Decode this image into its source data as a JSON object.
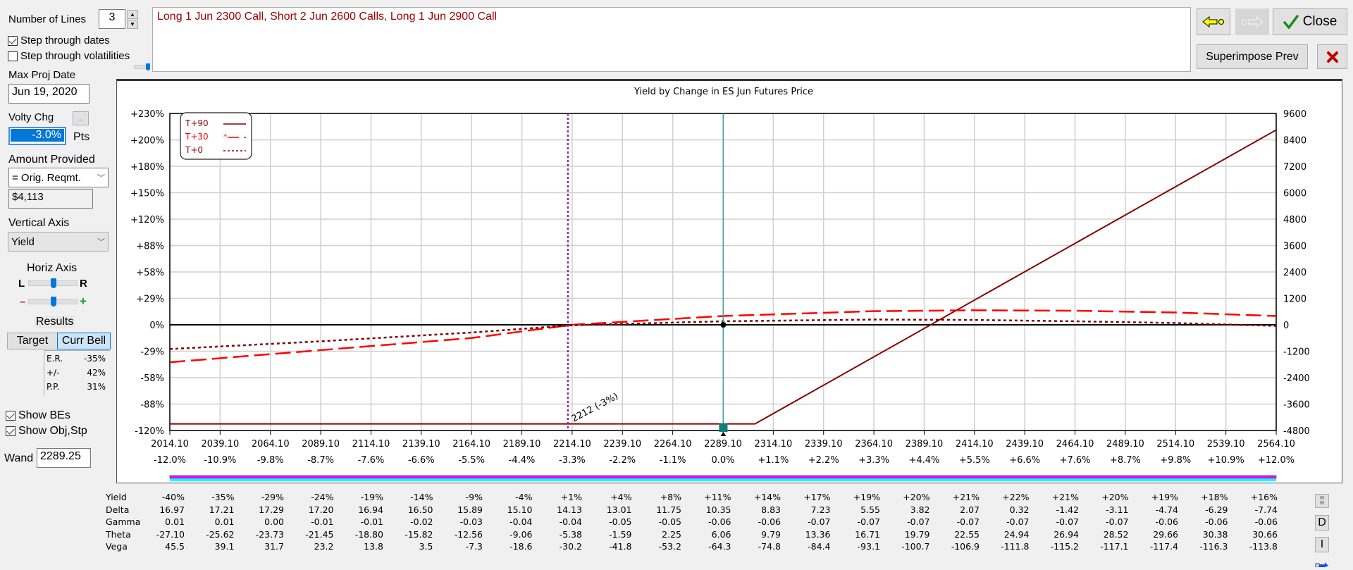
{
  "left_panel": {
    "number_of_lines_label": "Number of Lines",
    "number_of_lines_value": "3",
    "step_dates_label": "Step through dates",
    "step_dates_checked": true,
    "step_vols_label": "Step through volatilities",
    "step_vols_checked": false,
    "max_proj_date_label": "Max Proj Date",
    "max_proj_date_value": "Jun 19, 2020",
    "volty_chg_label": "Volty Chg",
    "volty_more_label": "...",
    "volty_chg_value": "-3.0%",
    "volty_units": "Pts",
    "amount_provided_label": "Amount Provided",
    "amount_provided_option": "= Orig. Reqmt.",
    "amount_value": "$4,113",
    "vertical_axis_label": "Vertical Axis",
    "vertical_axis_option": "Yield",
    "horiz_axis_label": "Horiz Axis",
    "slider_l": "L",
    "slider_r": "R",
    "slider_minus": "–",
    "slider_plus": "+",
    "results_label": "Results",
    "target_button": "Target",
    "curr_bell_button": "Curr Bell",
    "results": [
      {
        "label": "E.R.",
        "value": "-35%"
      },
      {
        "label": "+/-",
        "value": "42%"
      },
      {
        "label": "P.P.",
        "value": "31%"
      }
    ],
    "show_bes_label": "Show BEs",
    "show_bes_checked": true,
    "show_obj_label": "Show Obj,Stp",
    "show_obj_checked": true,
    "wand_label": "Wand",
    "wand_value": "2289.25"
  },
  "description": "Long 1 Jun 2300 Call, Short 2 Jun 2600 Calls, Long 1 Jun 2900 Call",
  "right_buttons": {
    "back_icon": "arrow-left-icon",
    "forward_icon": "arrow-right-icon",
    "close_label": "Close",
    "superimpose_label": "Superimpose Prev",
    "delete_icon": "x-icon"
  },
  "chart_data": {
    "type": "line",
    "title": "Yield by Change in ES Jun Futures Price",
    "xlabel": "",
    "ylabel": "Yield",
    "x_ticks": [
      "2014.10",
      "2039.10",
      "2064.10",
      "2089.10",
      "2114.10",
      "2139.10",
      "2164.10",
      "2189.10",
      "2214.10",
      "2239.10",
      "2264.10",
      "2289.10",
      "2314.10",
      "2339.10",
      "2364.10",
      "2389.10",
      "2414.10",
      "2439.10",
      "2464.10",
      "2489.10",
      "2514.10",
      "2539.10",
      "2564.10"
    ],
    "x_pct_ticks": [
      "-12.0%",
      "-10.9%",
      "-9.8%",
      "-8.7%",
      "-7.6%",
      "-6.6%",
      "-5.5%",
      "-4.4%",
      "-3.3%",
      "-2.2%",
      "-1.1%",
      "0.0%",
      "+1.1%",
      "+2.2%",
      "+3.3%",
      "+4.4%",
      "+5.5%",
      "+6.6%",
      "+7.6%",
      "+8.7%",
      "+9.8%",
      "+10.9%",
      "+12.0%"
    ],
    "xlim": [
      2014.1,
      2564.1
    ],
    "y_left_ticks": [
      "+230%",
      "+200%",
      "+180%",
      "+150%",
      "+120%",
      "+88%",
      "+58%",
      "+29%",
      "0%",
      "-29%",
      "-58%",
      "-88%",
      "-120%"
    ],
    "y_right_ticks": [
      "9600",
      "8400",
      "7200",
      "6000",
      "4800",
      "3600",
      "2400",
      "1200",
      "0",
      "-1200",
      "-2400",
      "-3600",
      "-4800"
    ],
    "ylim_right": [
      -4800,
      9600
    ],
    "grid": true,
    "legend_position": "top-left",
    "series": [
      {
        "name": "T+90",
        "style": "solid",
        "color": "#8b0000",
        "x": [
          2014.1,
          2305,
          2564.1
        ],
        "y": [
          -4500,
          -4500,
          8850
        ]
      },
      {
        "name": "T+30",
        "style": "dashed",
        "color": "#ff0000",
        "x": [
          2014.1,
          2089.1,
          2164.1,
          2214.1,
          2289.1,
          2364.1,
          2414.1,
          2464.1,
          2514.1,
          2564.1
        ],
        "y": [
          -1700,
          -1150,
          -600,
          0,
          400,
          620,
          660,
          640,
          560,
          400
        ]
      },
      {
        "name": "T+0",
        "style": "dotted",
        "color": "#800000",
        "x": [
          2014.1,
          2089.1,
          2164.1,
          2214.1,
          2289.1,
          2364.1,
          2414.1,
          2464.1,
          2514.1,
          2564.1
        ],
        "y": [
          -1100,
          -750,
          -350,
          -20,
          160,
          240,
          220,
          160,
          80,
          -50
        ]
      }
    ],
    "annotations": {
      "breakeven_label": "2212 (-3%)",
      "breakeven_x": 2212,
      "wand_x": 2289.25
    }
  },
  "greeks_table": {
    "rows": [
      {
        "name": "Yield",
        "values": [
          "-40%",
          "-35%",
          "-29%",
          "-24%",
          "-19%",
          "-14%",
          "-9%",
          "-4%",
          "+1%",
          "+4%",
          "+8%",
          "+11%",
          "+14%",
          "+17%",
          "+19%",
          "+20%",
          "+21%",
          "+22%",
          "+21%",
          "+20%",
          "+19%",
          "+18%",
          "+16%"
        ]
      },
      {
        "name": "Delta",
        "values": [
          "16.97",
          "17.21",
          "17.29",
          "17.20",
          "16.94",
          "16.50",
          "15.89",
          "15.10",
          "14.13",
          "13.01",
          "11.75",
          "10.35",
          "8.83",
          "7.23",
          "5.55",
          "3.82",
          "2.07",
          "0.32",
          "-1.42",
          "-3.11",
          "-4.74",
          "-6.29",
          "-7.74"
        ]
      },
      {
        "name": "Gamma",
        "values": [
          "0.01",
          "0.01",
          "0.00",
          "-0.01",
          "-0.01",
          "-0.02",
          "-0.03",
          "-0.04",
          "-0.04",
          "-0.05",
          "-0.05",
          "-0.06",
          "-0.06",
          "-0.07",
          "-0.07",
          "-0.07",
          "-0.07",
          "-0.07",
          "-0.07",
          "-0.07",
          "-0.06",
          "-0.06",
          "-0.06"
        ]
      },
      {
        "name": "Theta",
        "values": [
          "-27.10",
          "-25.62",
          "-23.73",
          "-21.45",
          "-18.80",
          "-15.82",
          "-12.56",
          "-9.06",
          "-5.38",
          "-1.59",
          "2.25",
          "6.06",
          "9.79",
          "13.36",
          "16.71",
          "19.79",
          "22.55",
          "24.94",
          "26.94",
          "28.52",
          "29.66",
          "30.38",
          "30.66"
        ]
      },
      {
        "name": "Vega",
        "values": [
          "45.5",
          "39.1",
          "31.7",
          "23.2",
          "13.8",
          "3.5",
          "-7.3",
          "-18.6",
          "-30.2",
          "-41.8",
          "-53.2",
          "-64.3",
          "-74.8",
          "-84.4",
          "-93.1",
          "-100.7",
          "-106.9",
          "-111.8",
          "-115.2",
          "-117.1",
          "-117.4",
          "-116.3",
          "-113.8"
        ]
      }
    ],
    "side_buttons": [
      "W",
      "D",
      "I"
    ]
  }
}
